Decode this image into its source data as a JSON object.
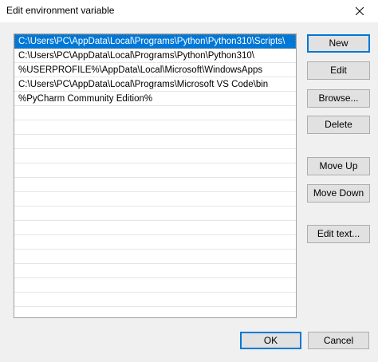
{
  "window": {
    "title": "Edit environment variable"
  },
  "list": {
    "items": [
      {
        "text": "C:\\Users\\PC\\AppData\\Local\\Programs\\Python\\Python310\\Scripts\\",
        "selected": true
      },
      {
        "text": "C:\\Users\\PC\\AppData\\Local\\Programs\\Python\\Python310\\",
        "selected": false
      },
      {
        "text": "%USERPROFILE%\\AppData\\Local\\Microsoft\\WindowsApps",
        "selected": false
      },
      {
        "text": "C:\\Users\\PC\\AppData\\Local\\Programs\\Microsoft VS Code\\bin",
        "selected": false
      },
      {
        "text": "%PyCharm Community Edition%",
        "selected": false
      }
    ]
  },
  "buttons": {
    "new": "New",
    "edit": "Edit",
    "browse": "Browse...",
    "delete": "Delete",
    "move_up": "Move Up",
    "move_down": "Move Down",
    "edit_text": "Edit text...",
    "ok": "OK",
    "cancel": "Cancel"
  },
  "colors": {
    "selection": "#0078d7",
    "window_bg": "#f0f0f0",
    "button_bg": "#e1e1e1"
  },
  "icons": {
    "close": "close-icon"
  }
}
